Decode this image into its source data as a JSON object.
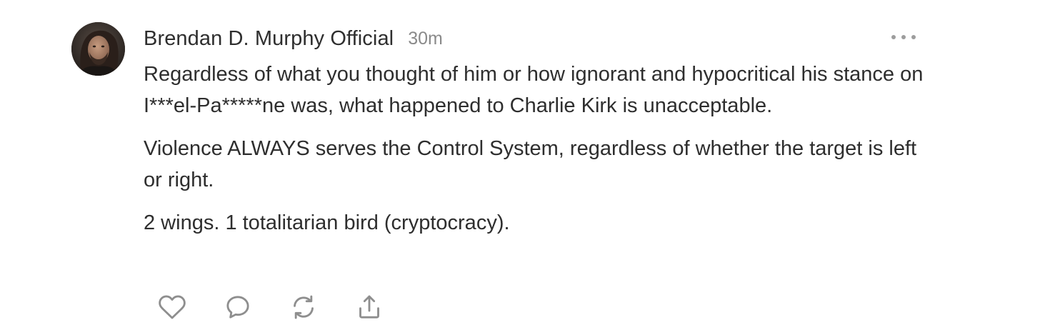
{
  "post": {
    "author": "Brendan D. Murphy Official",
    "timestamp": "30m",
    "paragraphs": [
      "Regardless of what you thought of him or how ignorant and hypocritical his stance on I***el-Pa*****ne was, what happened to Charlie Kirk is unacceptable.",
      "Violence ALWAYS serves the Control System, regardless of whether the target is left or right.",
      "2 wings. 1 totalitarian bird (cryptocracy)."
    ]
  },
  "icons": {
    "more": "more-horizontal-icon",
    "like": "heart-icon",
    "reply": "speech-bubble-icon",
    "restack": "refresh-arrows-icon",
    "share": "share-upload-icon"
  },
  "colors": {
    "text": "#2e2e2e",
    "muted": "#8a8a8a",
    "icon": "#8e8e8e"
  }
}
